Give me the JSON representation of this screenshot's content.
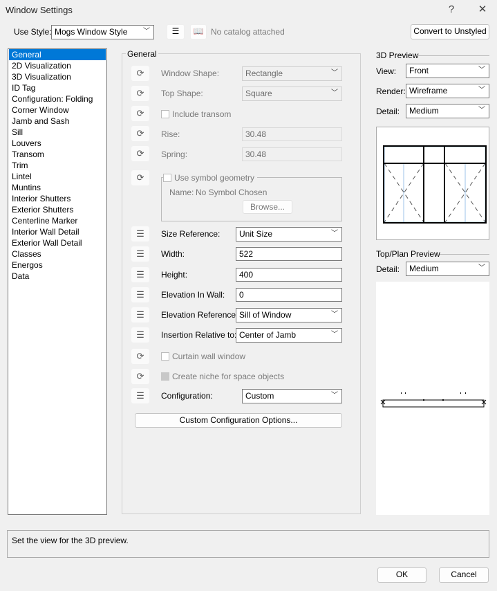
{
  "title": "Window Settings",
  "titlebar": {
    "help": "?",
    "close": "✕"
  },
  "style": {
    "label": "Use Style:",
    "value": "Mogs Window Style",
    "catalog": "No catalog attached",
    "convert": "Convert to Unstyled"
  },
  "nav": [
    "General",
    "2D Visualization",
    "3D Visualization",
    "ID Tag",
    "Configuration: Folding",
    "Corner Window",
    "Jamb and Sash",
    "Sill",
    "Louvers",
    "Transom",
    "Trim",
    "Lintel",
    "Muntins",
    "Interior Shutters",
    "Exterior Shutters",
    "Centerline Marker",
    "Interior Wall Detail",
    "Exterior Wall Detail",
    "Classes",
    "Energos",
    "Data"
  ],
  "general": {
    "title": "General",
    "window_shape": {
      "label": "Window Shape:",
      "value": "Rectangle"
    },
    "top_shape": {
      "label": "Top Shape:",
      "value": "Square"
    },
    "include_transom": "Include transom",
    "rise": {
      "label": "Rise:",
      "value": "30.48"
    },
    "spring": {
      "label": "Spring:",
      "value": "30.48"
    },
    "symbol": {
      "label": "Use symbol geometry",
      "name_label": "Name:",
      "name_value": "No Symbol Chosen",
      "browse": "Browse..."
    },
    "size_reference": {
      "label": "Size Reference:",
      "value": "Unit Size"
    },
    "width": {
      "label": "Width:",
      "value": "522"
    },
    "height": {
      "label": "Height:",
      "value": "400"
    },
    "elevation": {
      "label": "Elevation In Wall:",
      "value": "0"
    },
    "elevation_ref": {
      "label": "Elevation Reference:",
      "value": "Sill of Window"
    },
    "insertion": {
      "label": "Insertion Relative to:",
      "value": "Center of Jamb"
    },
    "curtain": "Curtain wall window",
    "niche": "Create niche for space objects",
    "configuration": {
      "label": "Configuration:",
      "value": "Custom"
    },
    "custom_options": "Custom Configuration Options..."
  },
  "preview3d": {
    "title": "3D Preview",
    "view_label": "View:",
    "view": "Front",
    "render_label": "Render:",
    "render": "Wireframe",
    "detail_label": "Detail:",
    "detail": "Medium"
  },
  "plan": {
    "title": "Top/Plan Preview",
    "detail_label": "Detail:",
    "detail": "Medium"
  },
  "status": "Set the view for the 3D preview.",
  "ok": "OK",
  "cancel": "Cancel"
}
